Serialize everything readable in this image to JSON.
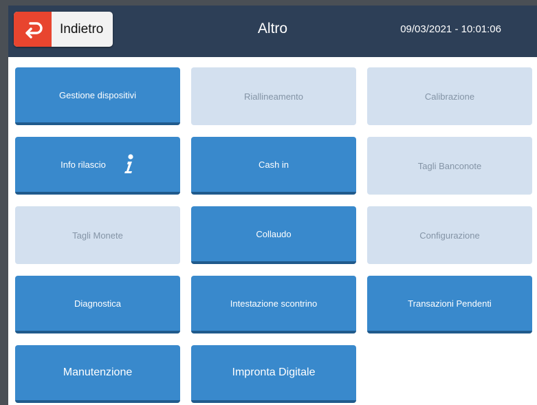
{
  "header": {
    "back_label": "Indietro",
    "title": "Altro",
    "datetime": "09/03/2021 - 10:01:06"
  },
  "tiles": [
    {
      "label": "Gestione dispositivi",
      "state": "active"
    },
    {
      "label": "Riallineamento",
      "state": "disabled"
    },
    {
      "label": "Calibrazione",
      "state": "disabled"
    },
    {
      "label": "Info rilascio",
      "state": "active",
      "icon": "info-icon"
    },
    {
      "label": "Cash in",
      "state": "active"
    },
    {
      "label": "Tagli Banconote",
      "state": "disabled"
    },
    {
      "label": "Tagli Monete",
      "state": "disabled"
    },
    {
      "label": "Collaudo",
      "state": "active"
    },
    {
      "label": "Configurazione",
      "state": "disabled"
    },
    {
      "label": "Diagnostica",
      "state": "active"
    },
    {
      "label": "Intestazione scontrino",
      "state": "active"
    },
    {
      "label": "Transazioni Pendenti",
      "state": "active"
    },
    {
      "label": "Manutenzione",
      "state": "active"
    },
    {
      "label": "Impronta Digitale",
      "state": "active"
    }
  ],
  "colors": {
    "header_bg": "#2d3f57",
    "back_accent": "#e8452f",
    "tile_active": "#3989cc",
    "tile_disabled": "#d3e0ef"
  }
}
